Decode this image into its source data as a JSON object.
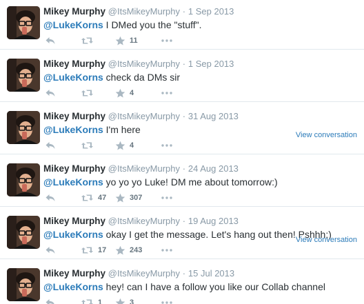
{
  "tweets": [
    {
      "fullname": "Mikey Murphy",
      "username": "@ItsMikeyMurphy",
      "separator": "·",
      "time": "1 Sep 2013",
      "mention": "@LukeKorns",
      "body": " I DMed you the \"stuff\".",
      "retweets": "",
      "favorites": "11",
      "view_conversation": ""
    },
    {
      "fullname": "Mikey Murphy",
      "username": "@ItsMikeyMurphy",
      "separator": "·",
      "time": "1 Sep 2013",
      "mention": "@LukeKorns",
      "body": " check da DMs sir",
      "retweets": "",
      "favorites": "4",
      "view_conversation": ""
    },
    {
      "fullname": "Mikey Murphy",
      "username": "@ItsMikeyMurphy",
      "separator": "·",
      "time": "31 Aug 2013",
      "mention": "@LukeKorns",
      "body": " I'm here",
      "retweets": "",
      "favorites": "4",
      "view_conversation": "View conversation"
    },
    {
      "fullname": "Mikey Murphy",
      "username": "@ItsMikeyMurphy",
      "separator": "·",
      "time": "24 Aug 2013",
      "mention": "@LukeKorns",
      "body": " yo yo yo Luke! DM me about tomorrow:)",
      "retweets": "47",
      "favorites": "307",
      "view_conversation": ""
    },
    {
      "fullname": "Mikey Murphy",
      "username": "@ItsMikeyMurphy",
      "separator": "·",
      "time": "19 Aug 2013",
      "mention": "@LukeKorns",
      "body": " okay I get the message. Let's hang out then! Pshhh;)",
      "retweets": "17",
      "favorites": "243",
      "view_conversation": "View conversation"
    },
    {
      "fullname": "Mikey Murphy",
      "username": "@ItsMikeyMurphy",
      "separator": "·",
      "time": "15 Jul 2013",
      "mention": "@LukeKorns",
      "body": " hey! can I have a follow you like our Collab channel",
      "retweets": "1",
      "favorites": "3",
      "view_conversation": ""
    }
  ],
  "icons": {
    "reply": "reply-arrow-icon",
    "retweet": "retweet-icon",
    "favorite": "star-icon",
    "more": "more-dots-icon"
  },
  "colors": {
    "link": "#2b7bb9",
    "muted": "#8899a6",
    "icon": "#aab8c2",
    "divider": "#e1e8ed"
  }
}
